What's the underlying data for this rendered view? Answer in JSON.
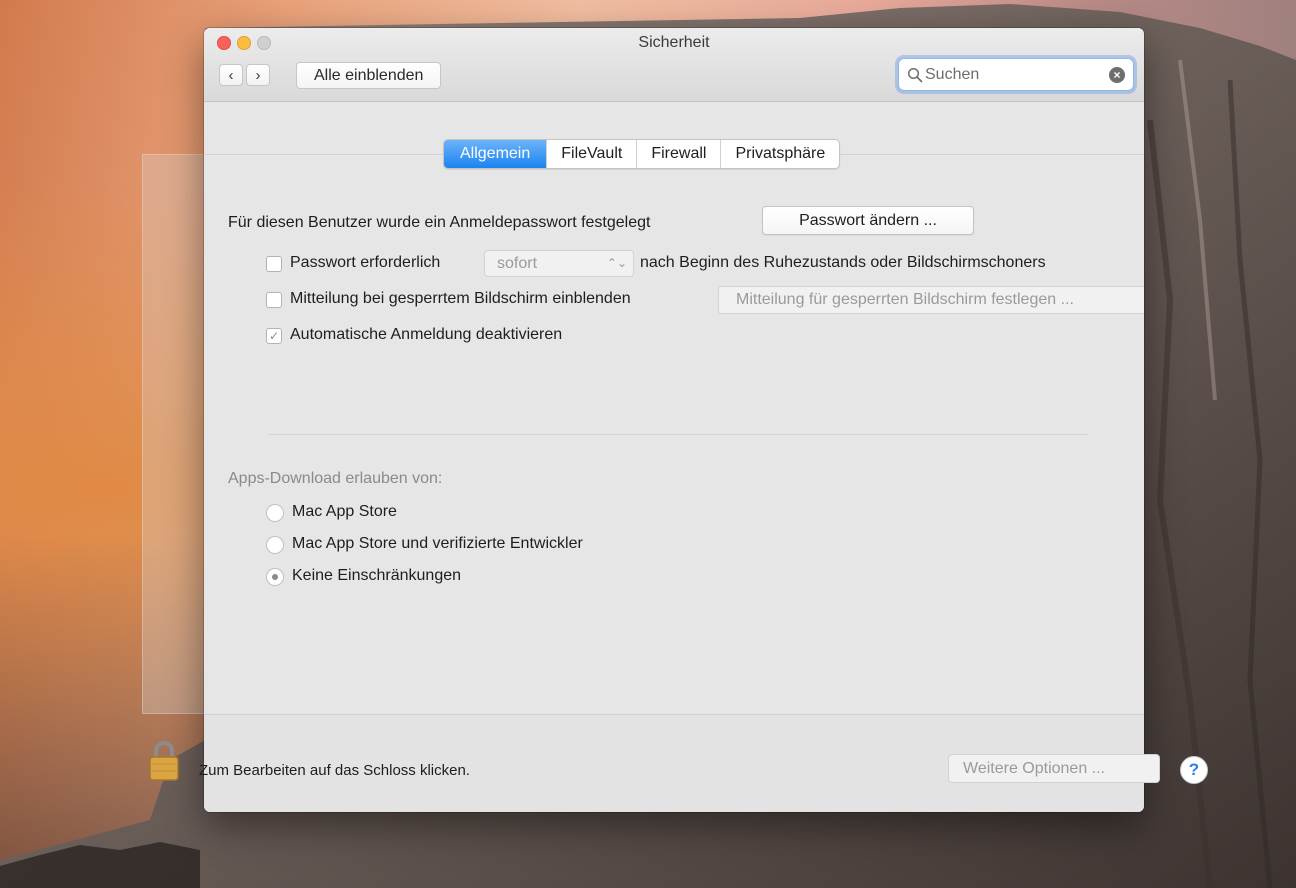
{
  "window": {
    "title": "Sicherheit"
  },
  "toolbar": {
    "back_label": "‹",
    "forward_label": "›",
    "show_all_label": "Alle einblenden",
    "search": {
      "placeholder": "Suchen",
      "value": ""
    }
  },
  "tabs": [
    {
      "label": "Allgemein",
      "active": true
    },
    {
      "label": "FileVault",
      "active": false
    },
    {
      "label": "Firewall",
      "active": false
    },
    {
      "label": "Privatsphäre",
      "active": false
    }
  ],
  "general": {
    "password_status": "Für diesen Benutzer wurde ein Anmeldepasswort festgelegt",
    "change_password_button": "Passwort ändern ...",
    "require_password": {
      "label": "Passwort erforderlich",
      "checked": false,
      "select_value": "sofort",
      "suffix": "nach Beginn des Ruhezustands oder Bildschirmschoners"
    },
    "lock_message": {
      "label": "Mitteilung bei gesperrtem Bildschirm einblenden",
      "checked": false,
      "button": "Mitteilung für gesperrten Bildschirm festlegen ..."
    },
    "disable_autologin": {
      "label": "Automatische Anmeldung deaktivieren",
      "checked": true,
      "check_glyph": "✓"
    }
  },
  "downloads": {
    "section_label": "Apps-Download erlauben von:",
    "options": [
      {
        "label": "Mac App Store",
        "selected": false
      },
      {
        "label": "Mac App Store und verifizierte Entwickler",
        "selected": false
      },
      {
        "label": "Keine Einschränkungen",
        "selected": true
      }
    ]
  },
  "footer": {
    "lock_hint": "Zum Bearbeiten auf das Schloss klicken.",
    "more_options_button": "Weitere Optionen ...",
    "help_label": "?"
  },
  "colors": {
    "accent": "#1c84f0",
    "close": "#fc605b",
    "minimize": "#fdbc40",
    "zoom_inactive": "#d0d0d0"
  },
  "icons": {
    "search": "search-icon",
    "clear": "clear-search-icon",
    "lock": "padlock-icon",
    "help": "help-icon",
    "popup": "popup-arrows-icon"
  }
}
